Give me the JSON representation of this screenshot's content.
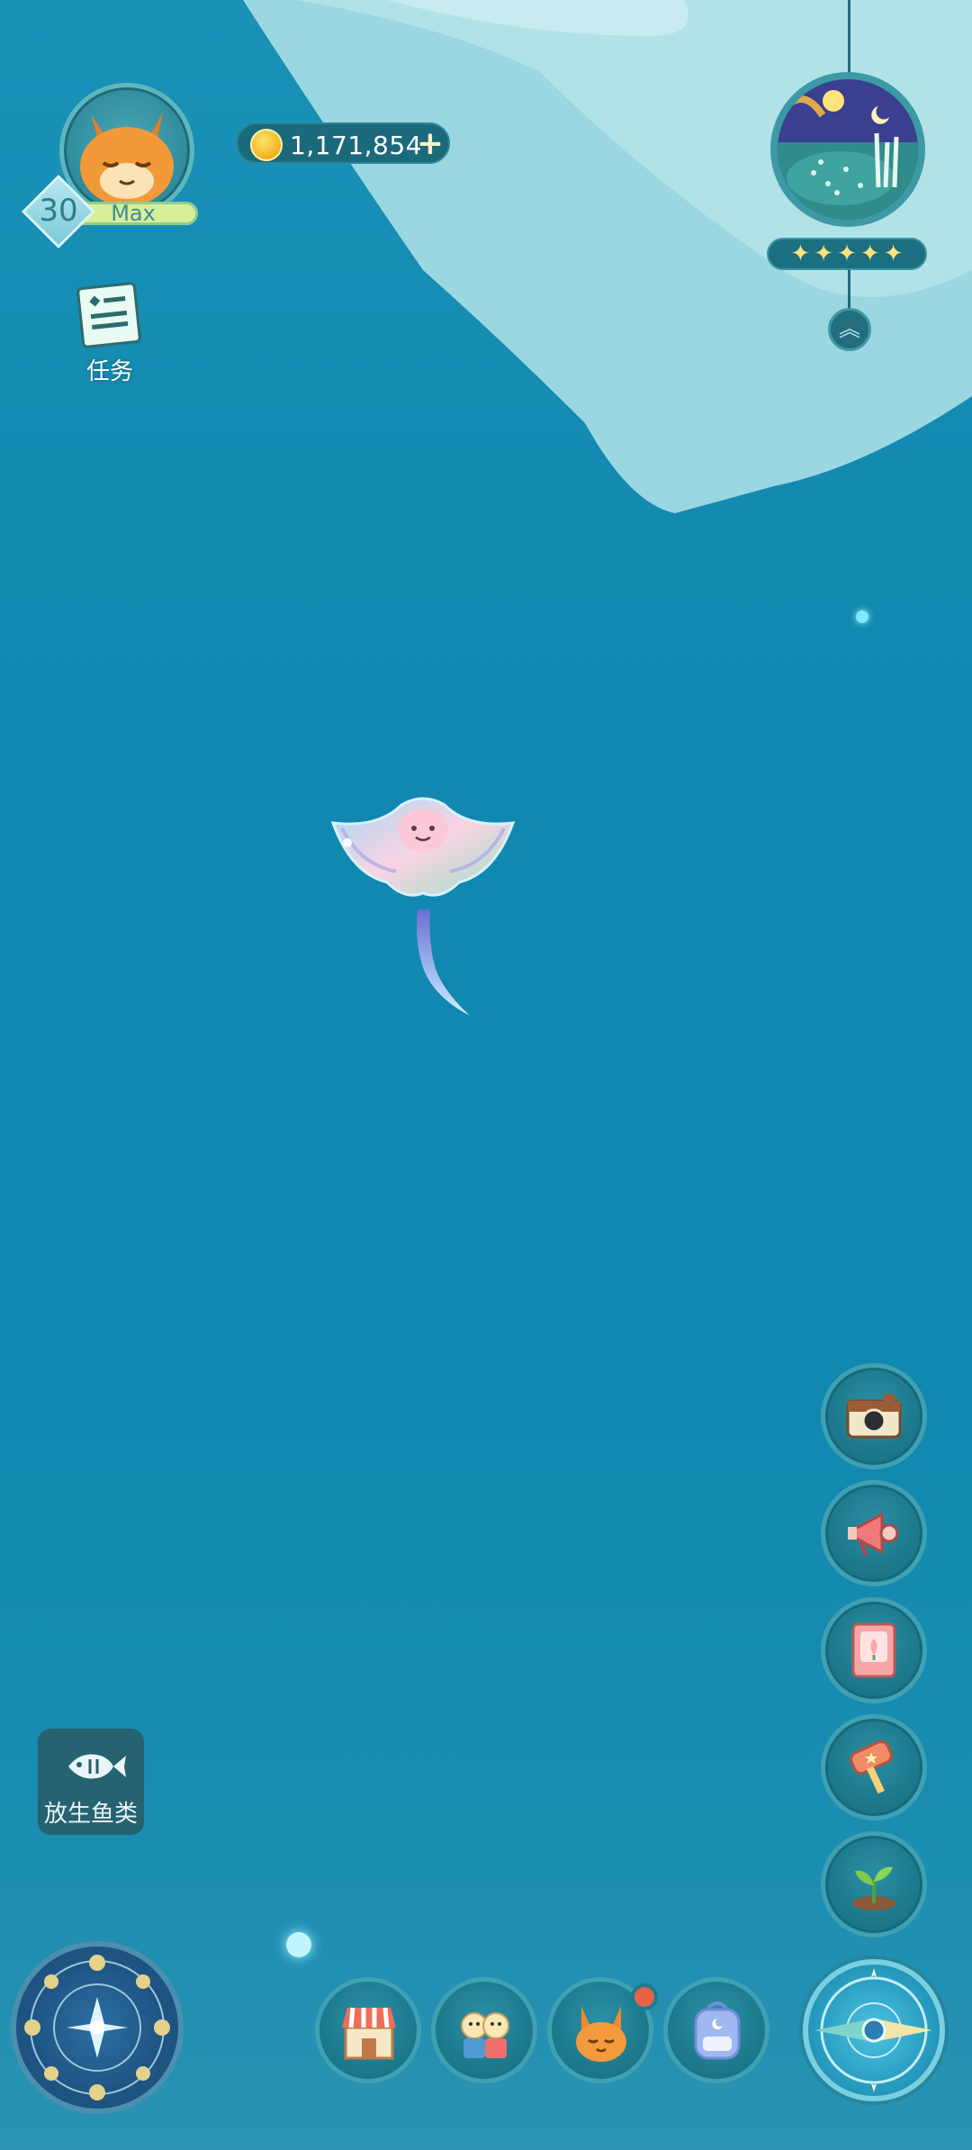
{
  "player": {
    "level": "30",
    "level_status": "Max",
    "coins": "1,171,854",
    "coin_add_symbol": "+"
  },
  "task": {
    "label": "任务"
  },
  "scene": {
    "rating_stars": 5,
    "star_symbol": "✦",
    "expand_symbol": "︽"
  },
  "release_fish": {
    "label": "放生鱼类"
  },
  "side_buttons": [
    {
      "icon": "camera-icon"
    },
    {
      "icon": "megaphone-icon"
    },
    {
      "icon": "fish-guide-book-icon"
    },
    {
      "icon": "mallet-icon"
    },
    {
      "icon": "sprout-icon"
    }
  ],
  "bottom_nav": [
    {
      "icon": "shop-icon"
    },
    {
      "icon": "friends-icon"
    },
    {
      "icon": "fox-companion-icon",
      "has_badge": true
    },
    {
      "icon": "backpack-icon"
    }
  ],
  "colors": {
    "ocean": "#1389b0",
    "button_ring": "#3fa1b3",
    "coin_gold": "#f1b11d",
    "badge_red": "#e56246",
    "level_bar": "#d8ef9a"
  }
}
